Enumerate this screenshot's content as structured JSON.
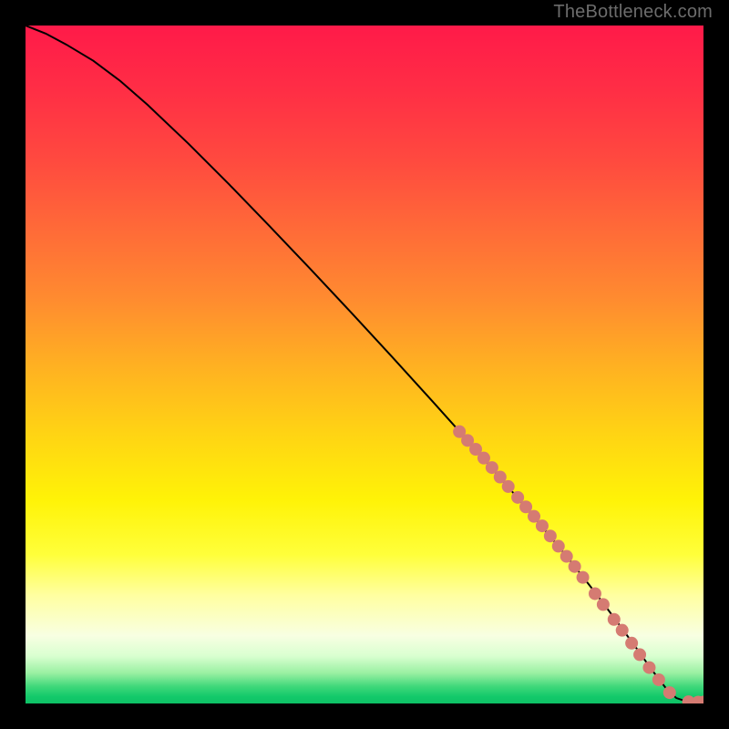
{
  "attribution": "TheBottleneck.com",
  "colors": {
    "bg": "#000000",
    "curve": "#000000",
    "marker": "#d57b72",
    "gradient_stops": [
      {
        "offset": 0.0,
        "color": "#ff1a49"
      },
      {
        "offset": 0.1,
        "color": "#ff2f45"
      },
      {
        "offset": 0.2,
        "color": "#ff4a3f"
      },
      {
        "offset": 0.3,
        "color": "#ff6a38"
      },
      {
        "offset": 0.4,
        "color": "#ff8a30"
      },
      {
        "offset": 0.5,
        "color": "#ffb022"
      },
      {
        "offset": 0.6,
        "color": "#ffd314"
      },
      {
        "offset": 0.7,
        "color": "#fff307"
      },
      {
        "offset": 0.78,
        "color": "#ffff3a"
      },
      {
        "offset": 0.84,
        "color": "#ffffa0"
      },
      {
        "offset": 0.9,
        "color": "#f8ffe2"
      },
      {
        "offset": 0.93,
        "color": "#d9ffd0"
      },
      {
        "offset": 0.955,
        "color": "#9af0a2"
      },
      {
        "offset": 0.975,
        "color": "#3fd87a"
      },
      {
        "offset": 0.99,
        "color": "#13c96a"
      },
      {
        "offset": 1.0,
        "color": "#0ec266"
      }
    ]
  },
  "chart_data": {
    "type": "line",
    "title": "",
    "xlabel": "",
    "ylabel": "",
    "xlim": [
      0,
      100
    ],
    "ylim": [
      0,
      100
    ],
    "grid": false,
    "legend": false,
    "series": [
      {
        "name": "curve",
        "x": [
          0,
          3,
          6,
          10,
          14,
          18,
          24,
          30,
          36,
          42,
          48,
          54,
          60,
          66,
          72,
          76,
          80,
          84,
          87,
          90,
          92.5,
          94.5,
          96,
          97.5,
          99,
          100
        ],
        "y": [
          100,
          98.8,
          97.2,
          94.8,
          91.8,
          88.3,
          82.6,
          76.6,
          70.4,
          64.1,
          57.7,
          51.2,
          44.6,
          37.9,
          31.0,
          26.3,
          21.5,
          16.4,
          12.4,
          8.3,
          4.8,
          2.2,
          0.8,
          0.3,
          0.2,
          0.2
        ]
      }
    ],
    "markers": {
      "name": "highlighted-points",
      "x": [
        64.0,
        65.2,
        66.4,
        67.6,
        68.8,
        70.0,
        71.2,
        72.6,
        73.8,
        75.0,
        76.2,
        77.4,
        78.6,
        79.8,
        81.0,
        82.2,
        84.0,
        85.2,
        86.8,
        88.0,
        89.4,
        90.6,
        92.0,
        93.4,
        95.0,
        97.8,
        99.2,
        100.0
      ],
      "y": [
        40.1,
        38.8,
        37.5,
        36.2,
        34.8,
        33.4,
        32.0,
        30.4,
        29.0,
        27.6,
        26.2,
        24.7,
        23.2,
        21.7,
        20.2,
        18.6,
        16.2,
        14.6,
        12.4,
        10.8,
        8.9,
        7.2,
        5.3,
        3.5,
        1.6,
        0.25,
        0.2,
        0.2
      ]
    }
  }
}
